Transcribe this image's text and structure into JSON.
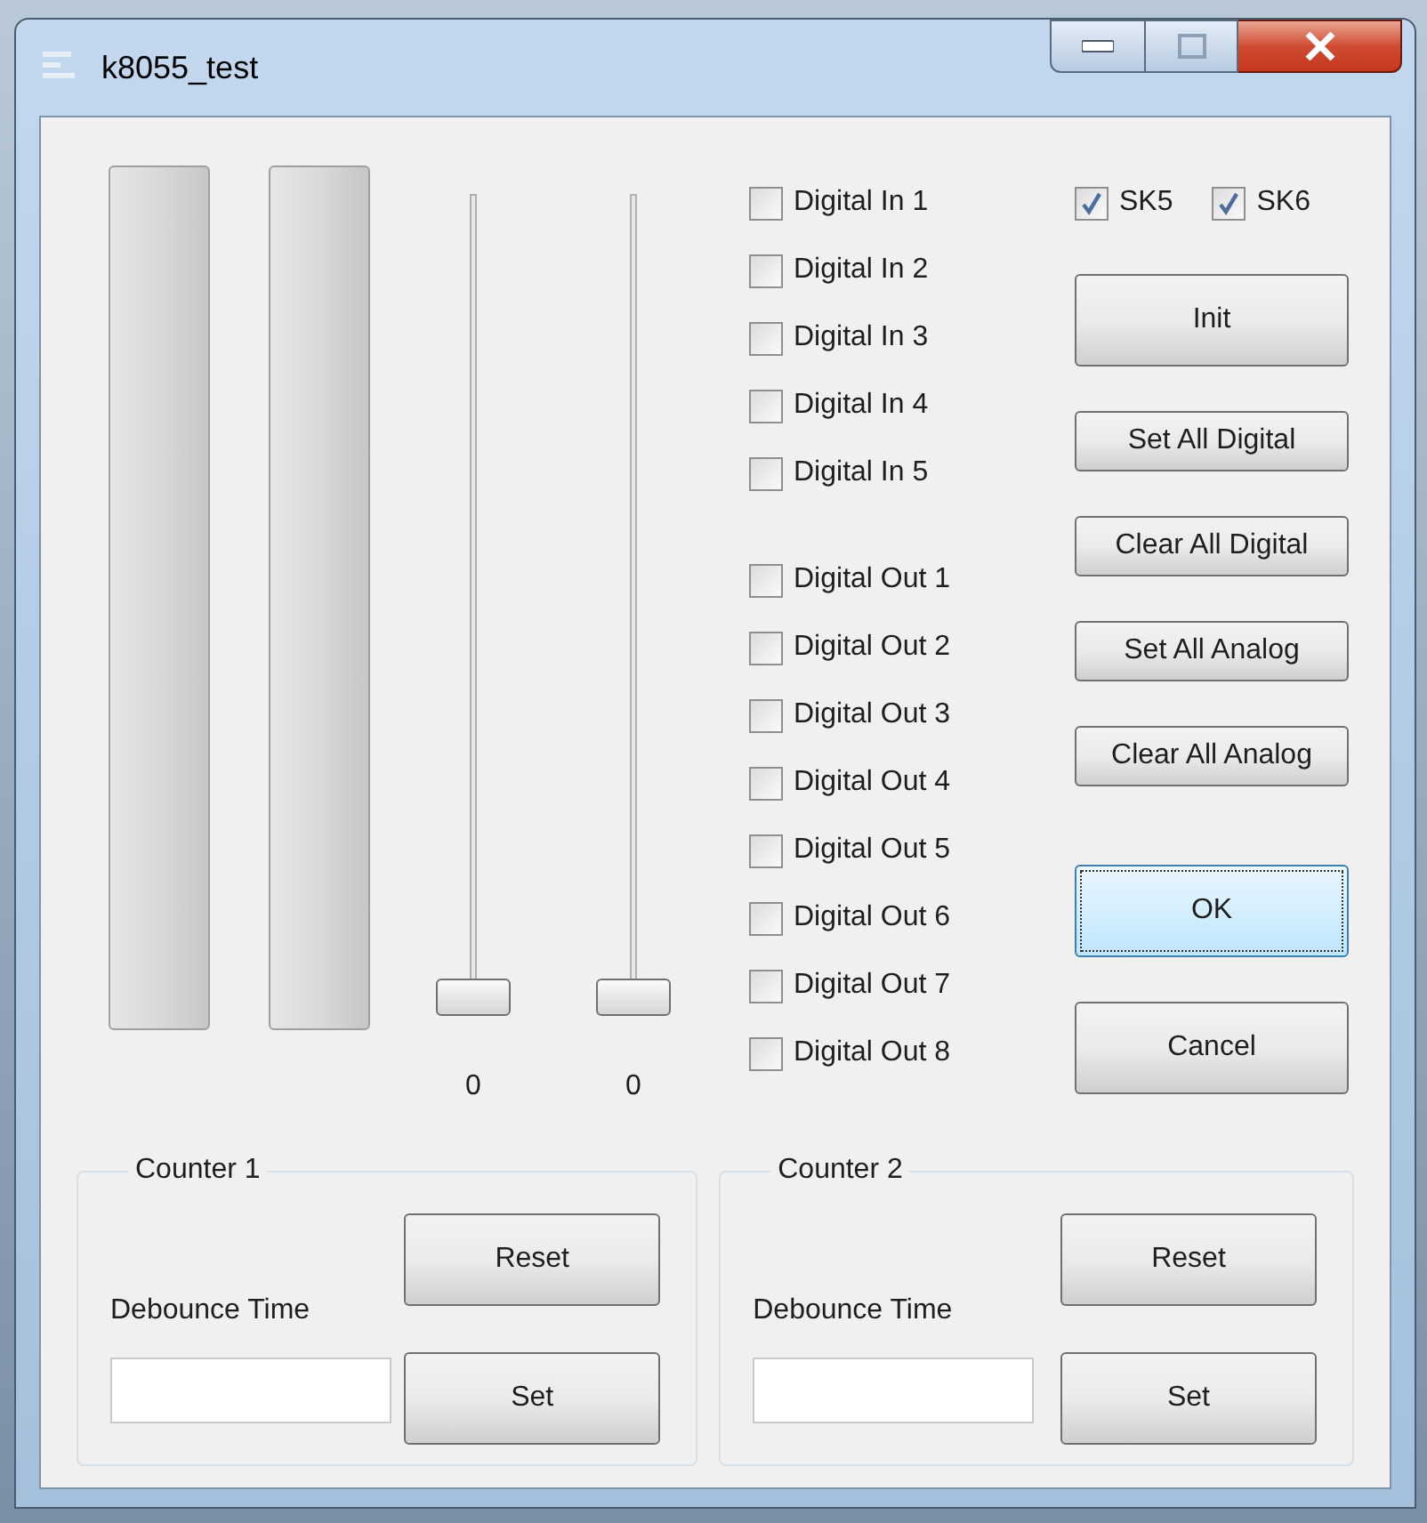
{
  "window": {
    "title": "k8055_test"
  },
  "meters": [
    {
      "level": 0
    },
    {
      "level": 0
    }
  ],
  "sliders": [
    {
      "level": 0,
      "reading": "0"
    },
    {
      "level": 0,
      "reading": "0"
    }
  ],
  "digital_inputs": [
    {
      "label": "Digital In 1",
      "checked": false
    },
    {
      "label": "Digital In 2",
      "checked": false
    },
    {
      "label": "Digital In 3",
      "checked": false
    },
    {
      "label": "Digital In 4",
      "checked": false
    },
    {
      "label": "Digital In 5",
      "checked": false
    }
  ],
  "digital_outputs": [
    {
      "label": "Digital Out 1",
      "checked": false
    },
    {
      "label": "Digital Out 2",
      "checked": false
    },
    {
      "label": "Digital Out 3",
      "checked": false
    },
    {
      "label": "Digital Out 4",
      "checked": false
    },
    {
      "label": "Digital Out 5",
      "checked": false
    },
    {
      "label": "Digital Out 6",
      "checked": false
    },
    {
      "label": "Digital Out 7",
      "checked": false
    },
    {
      "label": "Digital Out 8",
      "checked": false
    }
  ],
  "options": [
    {
      "label": "SK5",
      "checked": true
    },
    {
      "label": "SK6",
      "checked": true
    }
  ],
  "buttons": [
    {
      "label": "Init",
      "kind": "large",
      "focused": false
    },
    {
      "label": "Set All Digital",
      "kind": "compact",
      "focused": false
    },
    {
      "label": "Clear All Digital",
      "kind": "compact",
      "focused": false
    },
    {
      "label": "Set All Analog",
      "kind": "compact",
      "focused": false
    },
    {
      "label": "Clear All Analog",
      "kind": "compact",
      "focused": false
    },
    {
      "label": "OK",
      "kind": "large",
      "focused": true
    },
    {
      "label": "Cancel",
      "kind": "large",
      "focused": false
    }
  ],
  "counters": [
    {
      "title": "Counter 1",
      "reset": "Reset",
      "debounce_label": "Debounce Time",
      "set": "Set"
    },
    {
      "title": "Counter 2",
      "reset": "Reset",
      "debounce_label": "Debounce Time",
      "set": "Set"
    }
  ]
}
